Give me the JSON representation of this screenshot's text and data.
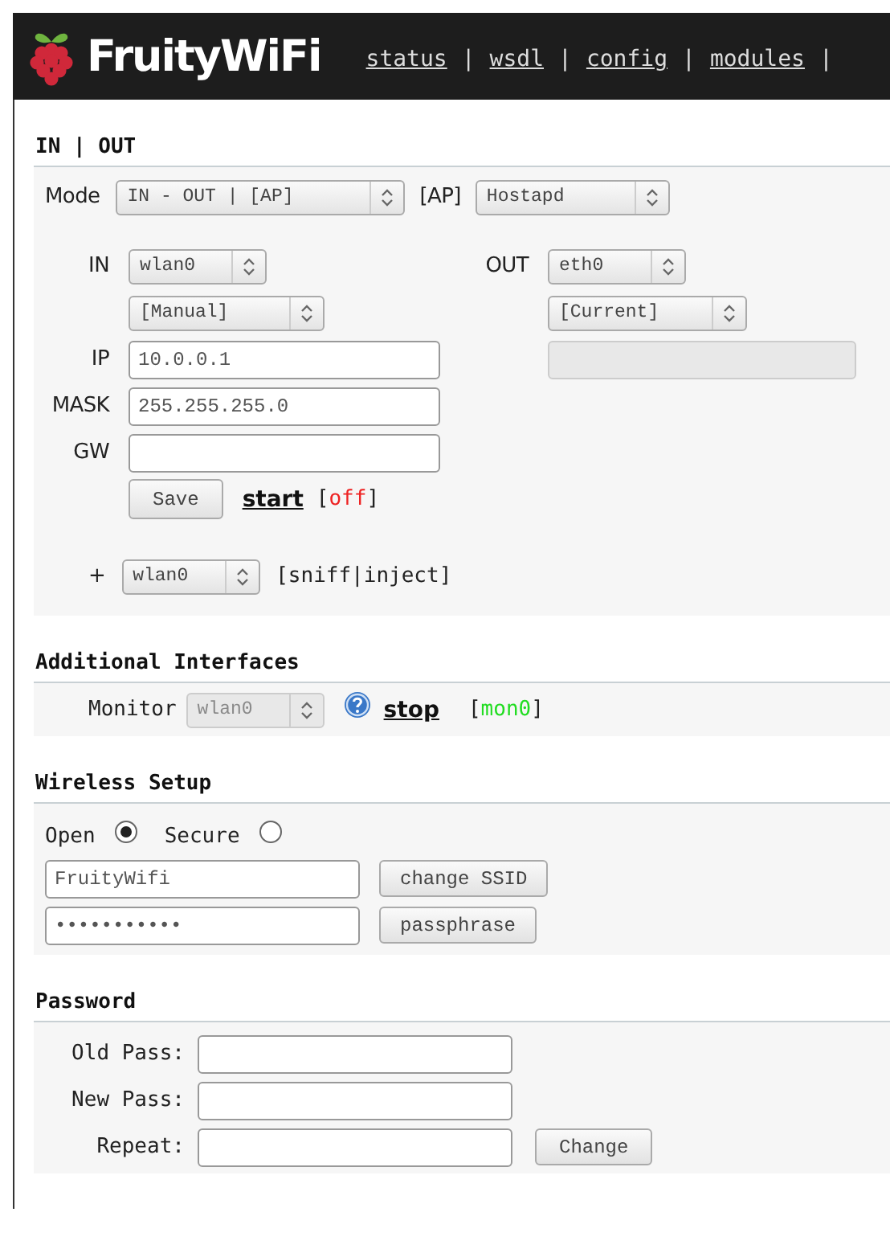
{
  "header": {
    "brand": "FruityWiFi",
    "nav": [
      {
        "kind": "link",
        "text": "status"
      },
      {
        "kind": "separator",
        "text": "|"
      },
      {
        "kind": "link",
        "text": "wsdl"
      },
      {
        "kind": "separator",
        "text": "|"
      },
      {
        "kind": "link",
        "text": "config"
      },
      {
        "kind": "separator",
        "text": "|"
      },
      {
        "kind": "link",
        "text": "modules"
      },
      {
        "kind": "separator",
        "text": "|"
      }
    ]
  },
  "in_out": {
    "title": "IN | OUT",
    "mode": {
      "label": "Mode",
      "select": "IN - OUT | [AP]",
      "ap_label": "[AP]",
      "ap_select": "Hostapd"
    },
    "in": {
      "label": "IN",
      "select": "wlan0",
      "method": "[Manual]"
    },
    "out": {
      "label": "OUT",
      "select": "eth0",
      "method": "[Current]",
      "address_disabled": true
    },
    "fields": [
      {
        "label": "IP",
        "value": "10.0.0.1"
      },
      {
        "label": "MASK",
        "value": "255.255.255.0"
      },
      {
        "label": "GW"
      }
    ],
    "save_button": "Save",
    "start_link": "start",
    "status": {
      "prefix": "[",
      "text": "off",
      "suffix": "]",
      "on": false
    },
    "extra": {
      "label": "+",
      "select": "wlan0",
      "text": "[sniff|inject]"
    }
  },
  "additional": {
    "title": "Additional Interfaces",
    "monitor": {
      "label": "Monitor",
      "select": "wlan0",
      "disabled": true,
      "link": "stop",
      "status": {
        "prefix": "[",
        "text": "mon0",
        "suffix": "]",
        "on": true
      }
    }
  },
  "wireless": {
    "title": "Wireless Setup",
    "options": [
      {
        "label": "Open",
        "selected": true
      },
      {
        "label": "Secure",
        "selected": false
      }
    ],
    "ssid": {
      "value": "FruityWifi",
      "button": "change SSID"
    },
    "passphrase": {
      "value": "•••••••••••",
      "button": "passphrase"
    }
  },
  "password": {
    "title": "Password",
    "rows": [
      {
        "label": "Old Pass:"
      },
      {
        "label": "New Pass:"
      },
      {
        "label": "Repeat:"
      }
    ],
    "button": "Change"
  }
}
